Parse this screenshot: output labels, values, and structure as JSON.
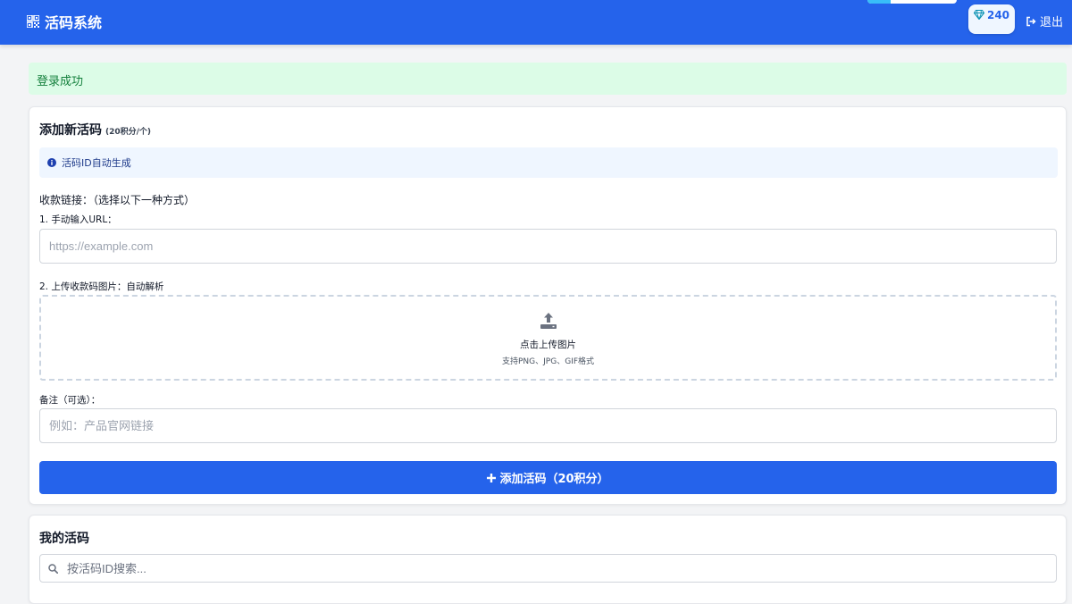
{
  "header": {
    "app_title": "活码系统",
    "points": "240",
    "logout_label": "退出"
  },
  "alert": {
    "message": "登录成功"
  },
  "add_card": {
    "title": "添加新活码",
    "cost_note": "(20积分/个)",
    "info_text": "活码ID自动生成",
    "payment_label": "收款链接：（选择以下一种方式）",
    "url_label": "1. 手动输入URL：",
    "url_placeholder": "https://example.com",
    "upload_label": "2. 上传收款码图片：自动解析",
    "upload_title": "点击上传图片",
    "upload_hint": "支持PNG、JPG、GIF格式",
    "remark_label": "备注（可选）：",
    "remark_placeholder": "例如：产品官网链接",
    "submit_label": "添加活码（20积分）"
  },
  "list_card": {
    "title": "我的活码",
    "search_placeholder": "按活码ID搜索..."
  },
  "colors": {
    "primary": "#2563eb",
    "success_bg": "#dcfce7",
    "success_text": "#15803d",
    "info_bg": "#eff6ff"
  },
  "icons": {
    "brand": "qrcode-icon",
    "points": "gem-icon",
    "logout": "sign-out-icon",
    "info": "info-circle-icon",
    "upload": "upload-icon",
    "add": "plus-icon",
    "search": "search-icon"
  }
}
